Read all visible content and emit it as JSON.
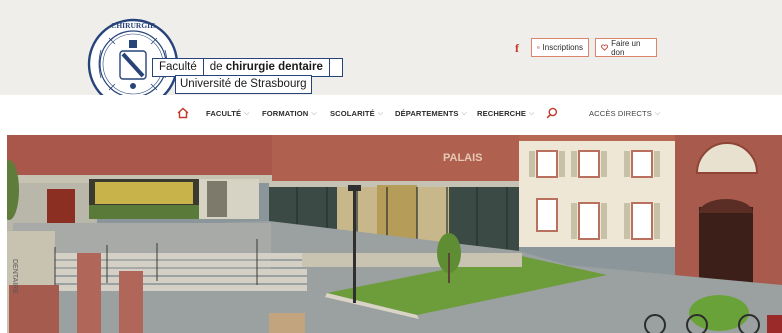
{
  "header": {
    "seal_icon": "faculty-seal-icon",
    "faculty_prefix": "Faculté",
    "faculty_mid": "de ",
    "faculty_bold": "chirurgie dentaire",
    "university": "Université de Strasbourg",
    "facebook_icon": "facebook-icon",
    "inscriptions_label": "Inscriptions",
    "inscriptions_icon": "id-card-icon",
    "don_label": "Faire un don",
    "don_icon": "heart-icon"
  },
  "nav": {
    "home_icon": "home-icon",
    "items": [
      {
        "label": "FACULTÉ"
      },
      {
        "label": "FORMATION"
      },
      {
        "label": "SCOLARITÉ"
      },
      {
        "label": "DÉPARTEMENTS"
      },
      {
        "label": "RECHERCHE"
      }
    ],
    "search_icon": "search-icon",
    "acces_label": "ACCÈS DIRECTS"
  },
  "hero": {
    "image_icon": "campus-courtyard-photo"
  },
  "colors": {
    "accent": "#c0392b",
    "logo_blue": "#27447a",
    "header_bg": "#efeeeb"
  }
}
